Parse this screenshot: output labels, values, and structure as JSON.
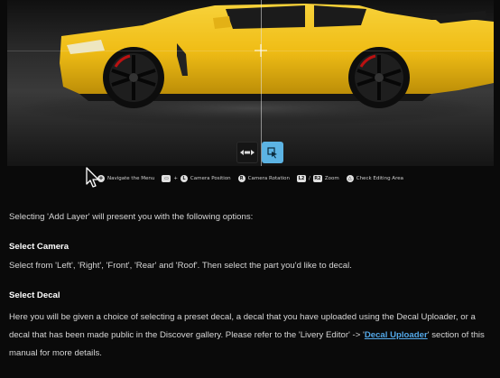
{
  "controls": [
    {
      "glyph": "✥",
      "label": "Navigate the Menu"
    },
    {
      "glyph": "▭",
      "glyph2": "L",
      "joiner": "+",
      "label": "Camera Position"
    },
    {
      "glyph": "R",
      "label": "Camera Rotation"
    },
    {
      "glyph": "L2",
      "glyph2": "R2",
      "joiner": "/",
      "label": "Zoom"
    },
    {
      "glyph": "△",
      "label": "Check Editing Area"
    }
  ],
  "content": {
    "intro": "Selecting 'Add Layer' will present you with the following options:",
    "select_camera": {
      "heading": "Select Camera",
      "text": "Select from 'Left', 'Right', 'Front', 'Rear' and 'Roof'. Then select the part you'd like to decal."
    },
    "select_decal": {
      "heading": "Select Decal",
      "text_1": "Here you will be given a choice of selecting a preset decal, a decal that you have uploaded using the Decal Uploader, or a decal that has been made public in the Discover gallery. Please refer to the ",
      "quote_open": "'Livery Editor' -> '",
      "link": "Decal Uploader",
      "quote_close": "'",
      "text_2": " section of this manual for more details."
    }
  },
  "colors": {
    "car_body": "#f3c21c",
    "accent_button": "#5cb3e3",
    "link": "#53a8e8"
  }
}
